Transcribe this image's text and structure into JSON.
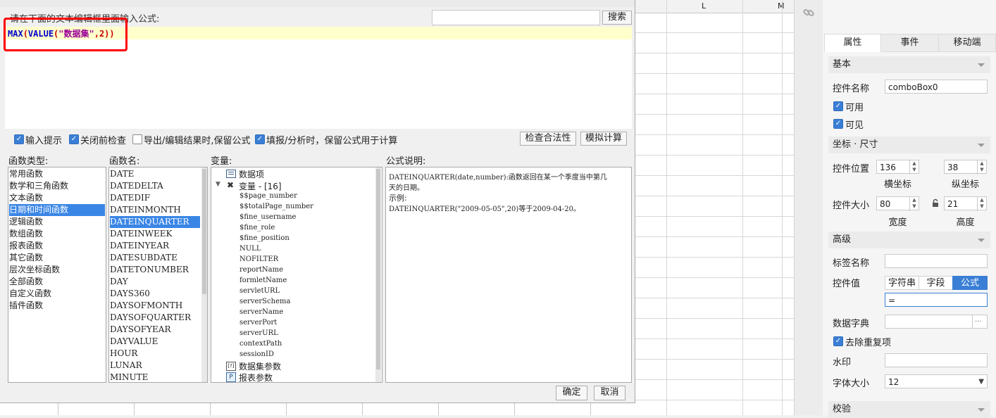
{
  "dialog": {
    "instruction": "请在下面的文本编辑框里面输入公式:",
    "search_placeholder": "",
    "search_button": "搜索",
    "formula": {
      "fn1": "MAX",
      "p1": "(",
      "fn2": "VALUE",
      "p2": "(",
      "str": "\"数据集\"",
      "rest": ",2))"
    },
    "options": [
      {
        "label": "输入提示",
        "checked": true
      },
      {
        "label": "关闭前检查",
        "checked": true
      },
      {
        "label": "导出/编辑结果时,保留公式",
        "checked": false
      },
      {
        "label": "填报/分析时，保留公式用于计算",
        "checked": true
      }
    ],
    "check_button": "检查合法性",
    "simulate_button": "模拟计算",
    "categories_heading": "函数类型:",
    "categories": [
      "常用函数",
      "数学和三角函数",
      "文本函数",
      "日期和时间函数",
      "逻辑函数",
      "数组函数",
      "报表函数",
      "其它函数",
      "层次坐标函数",
      "全部函数",
      "自定义函数",
      "插件函数"
    ],
    "selected_category": "日期和时间函数",
    "functions_heading": "函数名:",
    "functions": [
      "DATE",
      "DATEDELTA",
      "DATEDIF",
      "DATEINMONTH",
      "DATEINQUARTER",
      "DATEINWEEK",
      "DATEINYEAR",
      "DATESUBDATE",
      "DATETONUMBER",
      "DAY",
      "DAYS360",
      "DAYSOFMONTH",
      "DAYSOFQUARTER",
      "DAYSOFYEAR",
      "DAYVALUE",
      "HOUR",
      "LUNAR",
      "MINUTE"
    ],
    "selected_function": "DATEINQUARTER",
    "variables_heading": "变量:",
    "var_data_item": "数据项",
    "var_group": "变量 - [16]",
    "variables": [
      "$$page_number",
      "$$totalPage_number",
      "$fine_username",
      "$fine_role",
      "$fine_position",
      "NULL",
      "NOFILTER",
      "reportName",
      "formletName",
      "servletURL",
      "serverSchema",
      "serverName",
      "serverPort",
      "serverURL",
      "contextPath",
      "sessionID"
    ],
    "var_dataset_params": "数据集参数",
    "var_report_params": "报表参数",
    "desc_heading": "公式说明:",
    "desc_line1": "DATEINQUARTER(date,number):函数返回在某一个季度当中第几",
    "desc_line2": "天的日期。",
    "desc_line3": "示例:",
    "desc_line4": "DATEINQUARTER(\"2009-05-05\",20)等于2009-04-20。",
    "ok_button": "确定",
    "cancel_button": "取消"
  },
  "sheet": {
    "col_L": "L",
    "col_M": "M"
  },
  "panel": {
    "tabs": [
      "属性",
      "事件",
      "移动端"
    ],
    "basic_section": "基本",
    "name_label": "控件名称",
    "name_value": "comboBox0",
    "enabled_label": "可用",
    "visible_label": "可见",
    "coords_section": "坐标 · 尺寸",
    "pos_label": "控件位置",
    "pos_x": "136",
    "pos_y": "38",
    "x_label": "横坐标",
    "y_label": "纵坐标",
    "size_label": "控件大小",
    "width": "80",
    "height": "21",
    "w_label": "宽度",
    "h_label": "高度",
    "advanced_section": "高级",
    "tag_label": "标签名称",
    "tag_value": "",
    "value_label": "控件值",
    "value_types": [
      "字符串",
      "字段",
      "公式"
    ],
    "value_selected": "公式",
    "value_formula": "=",
    "dict_label": "数据字典",
    "dict_button": "···",
    "dedupe_label": "去除重复项",
    "watermark_label": "水印",
    "watermark_value": "",
    "font_size_label": "字体大小",
    "font_size_value": "12",
    "validate_section": "校验"
  },
  "colors": {
    "accent": "#3a7fd5",
    "selection": "#3a86e6",
    "highlight_line": "#ffffcc",
    "annotation": "#ff0000"
  }
}
